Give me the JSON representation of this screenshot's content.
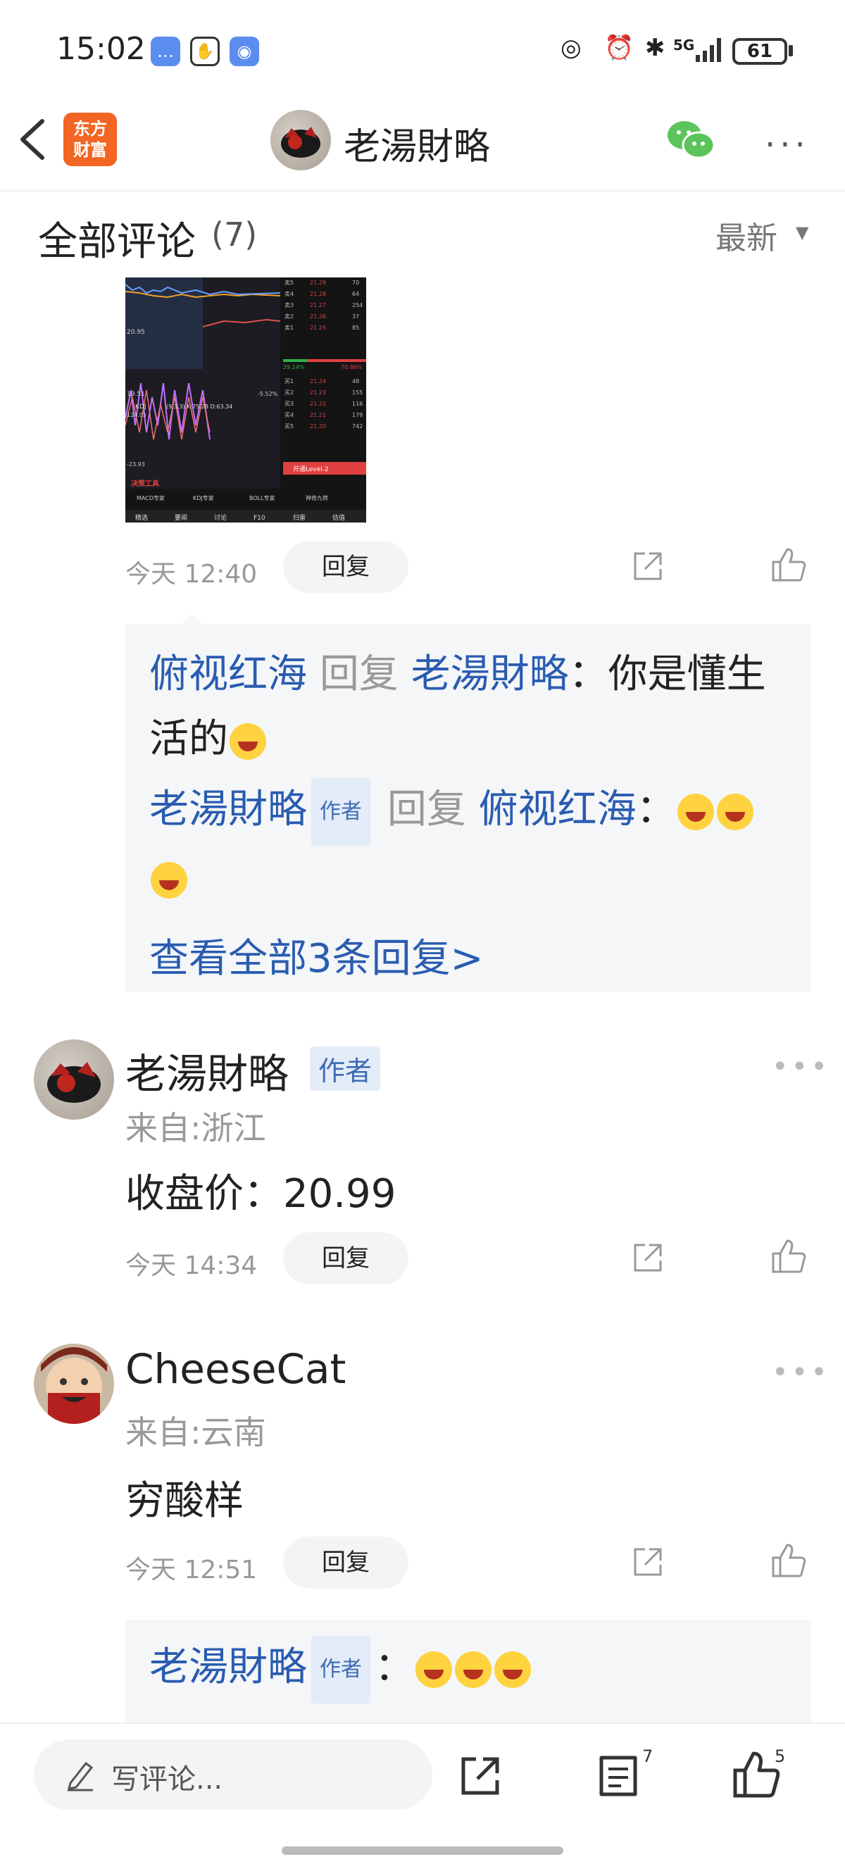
{
  "status_bar": {
    "time": "15:02",
    "signal": "5G",
    "battery": "61"
  },
  "header": {
    "logo_line1": "东方",
    "logo_line2": "财富",
    "title": "老湯財略",
    "icons": [
      "back-icon",
      "wechat-icon",
      "more-icon"
    ]
  },
  "comments_header": {
    "title": "全部评论",
    "count": "(7)",
    "sort": "最新"
  },
  "comment1": {
    "time": "今天 12:40",
    "reply_label": "回复",
    "replies": [
      {
        "user": "俯视红海",
        "verb": "回复",
        "target": "老湯財略",
        "sep": "：",
        "text1": "你是懂生",
        "text2": "活的"
      },
      {
        "user": "老湯財略",
        "tag": "作者",
        "verb": "回复",
        "target": "俯视红海",
        "sep": "："
      }
    ],
    "view_all": "查看全部3条回复>"
  },
  "comment2": {
    "user": "老湯財略",
    "tag": "作者",
    "location": "来自:浙江",
    "content": "收盘价：20.99",
    "time": "今天 14:34",
    "reply_label": "回复"
  },
  "comment3": {
    "user": "CheeseCat",
    "location": "来自:云南",
    "content": "穷酸样",
    "time": "今天 12:51",
    "reply_label": "回复",
    "sub_reply": {
      "user": "老湯財略",
      "tag": "作者",
      "sep": "："
    }
  },
  "bottom_bar": {
    "compose_placeholder": "写评论...",
    "comment_count": "7",
    "like_count": "5"
  },
  "chart_thumbnail": {
    "values": [
      "21.29",
      "21.28",
      "21.27",
      "21.26",
      "21.25",
      "21.24",
      "21.23",
      "21.22",
      "21.21",
      "21.20"
    ],
    "volumes": [
      "70",
      "64",
      "254",
      "37",
      "85",
      "48",
      "155",
      "116",
      "179",
      "742"
    ],
    "labels": [
      "卖5",
      "卖4",
      "卖3",
      "卖2",
      "卖1",
      "买1",
      "买2",
      "买3",
      "买4",
      "买5"
    ],
    "kdj": "KDJ",
    "kdj_params": "(9,3,3) K:75.28 D:63.34",
    "tabs": [
      "MACD专家",
      "KDJ专家",
      "BOLL专家",
      "神奇九转"
    ],
    "bottom_tabs": [
      "精选",
      "要闻",
      "讨论",
      "F10",
      "扫雷",
      "估值"
    ],
    "tool_label": "决策工具",
    "level2": "开通Level-2",
    "pct_up": "29.14%",
    "pct_down": "70.86%",
    "price_a": "20.95",
    "price_b": "19.51",
    "price_c": "124.05",
    "price_d": "-23.93",
    "pct_e": "-5.52%"
  }
}
